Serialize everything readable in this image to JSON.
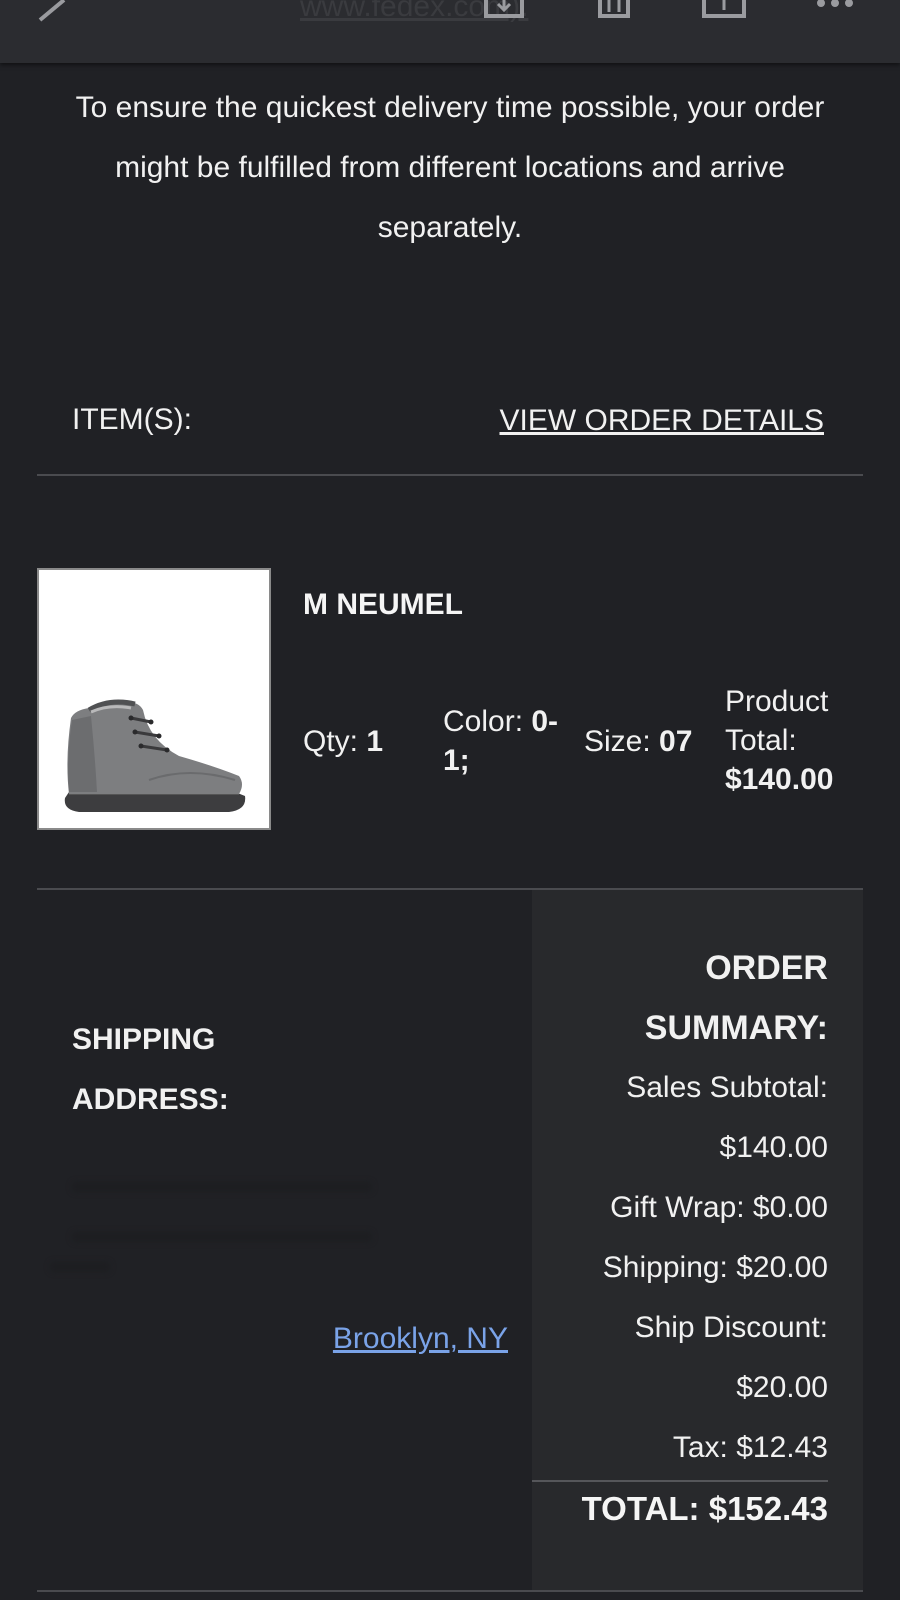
{
  "topbar": {
    "url_text": "www.fedex.com)."
  },
  "notice": "To ensure the quickest delivery time possible, your order might be fulfilled from different locations and arrive separately.",
  "items_header": "ITEM(S):",
  "view_details_link": "VIEW ORDER DETAILS",
  "product": {
    "name": "M NEUMEL",
    "qty_label": "Qty:",
    "qty_value": "1",
    "color_label": "Color:",
    "color_value": "0-1;",
    "size_label": "Size:",
    "size_value": "07",
    "total_label": "Product Total:",
    "total_value": "$140.00"
  },
  "shipping": {
    "label": "SHIPPING ADDRESS:",
    "city": "Brooklyn, NY"
  },
  "order_summary": {
    "title": "ORDER SUMMARY:",
    "subtotal": "Sales Subtotal: $140.00",
    "gift_wrap": "Gift Wrap: $0.00",
    "shipping": "Shipping: $20.00",
    "ship_discount": "Ship Discount: $20.00",
    "tax": "Tax: $12.43",
    "total": "TOTAL: $152.43"
  },
  "colors": {
    "background": "#202125",
    "summary_panel": "#28292c",
    "link_blue": "#7aa3e8"
  }
}
